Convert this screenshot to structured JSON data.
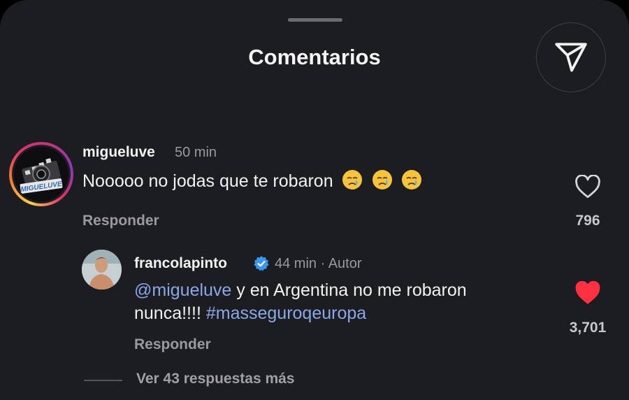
{
  "header": {
    "title": "Comentarios",
    "share_icon": "send-paper-plane-icon"
  },
  "comments": [
    {
      "username": "migueluve",
      "time": "50 min",
      "text": "Nooooo no jodas que te robaron",
      "emojis": [
        "crying-face",
        "crying-face",
        "crying-face"
      ],
      "avatar_text": "MIGUELUVE",
      "reply_label": "Responder",
      "likes": "796",
      "liked": false
    },
    {
      "username": "francolapinto",
      "verified": true,
      "time": "44 min",
      "separator": "·",
      "author_tag": "Autor",
      "mention": "@migueluve",
      "text_line1_rest": " y en Argentina no me robaron",
      "text_line2": "nunca!!!! ",
      "hashtag": "#masseguroqeuropa",
      "reply_label": "Responder",
      "likes": "3,701",
      "liked": true
    }
  ],
  "more_replies": "Ver 43 respuestas más",
  "colors": {
    "background": "#1c1d20",
    "link": "#8aa8e8",
    "like": "#ff3040",
    "verified": "#3897f0"
  }
}
